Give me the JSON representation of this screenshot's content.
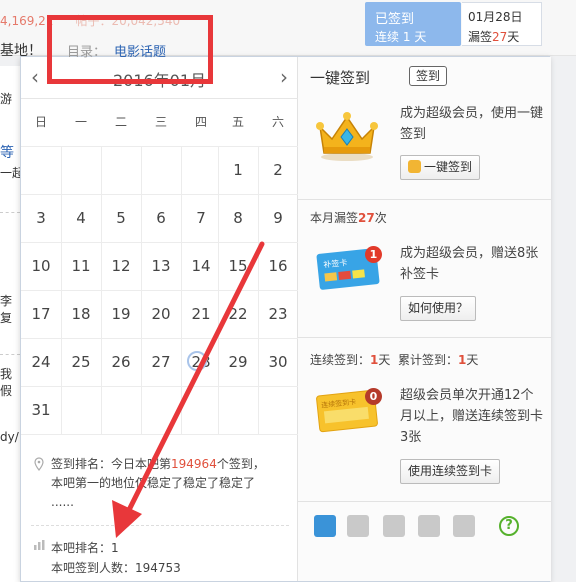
{
  "background": {
    "stat_text": "4,169,21",
    "stat_text_blurred": "帖子：20,042,540",
    "forum_title": "基地！",
    "left_items": [
      "游",
      "等",
      "一起",
      "李",
      "复",
      "我",
      "假",
      "dy/"
    ]
  },
  "sign_widget": {
    "status": "已签到",
    "streak_prefix": "连续",
    "streak_days": "1",
    "streak_suffix": "天",
    "date": "01月28日",
    "missed_prefix": "漏签",
    "missed_count": "27",
    "missed_suffix": "天"
  },
  "catalog": {
    "label": "目录：",
    "link": "电影话题"
  },
  "calendar": {
    "title": "2016年01月",
    "prev": "‹",
    "next": "›",
    "weekdays": [
      "日",
      "一",
      "二",
      "三",
      "四",
      "五",
      "六"
    ],
    "today": "28",
    "rows": [
      [
        "",
        "",
        "",
        "",
        "",
        "1",
        "2"
      ],
      [
        "3",
        "4",
        "5",
        "6",
        "7",
        "8",
        "9"
      ],
      [
        "10",
        "11",
        "12",
        "13",
        "14",
        "15",
        "16"
      ],
      [
        "17",
        "18",
        "19",
        "20",
        "21",
        "22",
        "23"
      ],
      [
        "24",
        "25",
        "26",
        "27",
        "28",
        "29",
        "30"
      ],
      [
        "31",
        "",
        "",
        "",
        "",
        "",
        ""
      ]
    ]
  },
  "ranking": {
    "sign_rank_prefix": "签到排名：今日本吧第",
    "sign_rank_num": "194964",
    "sign_rank_suffix": "个签到，",
    "sign_rank_line2": "本吧第一的地位仅稳定了稳定了稳定了",
    "sign_rank_line3": "......",
    "bar_rank": "本吧排名：1",
    "bar_signers": "本吧签到人数：194753"
  },
  "right_panel": {
    "title": "一键签到",
    "tag": "签到",
    "vip_text": "成为超级会员，使用一键签到",
    "onekey_btn": "一键签到",
    "missed_label": "本月漏签",
    "missed_count": "27",
    "missed_suffix": "次",
    "card_badge": "1",
    "card_text": "成为超级会员，赠送8张补签卡",
    "card_label": "补签卡",
    "howto_btn": "如何使用？",
    "streak_label": "连续签到：",
    "streak_num": "1",
    "streak_unit": "天",
    "total_label": "累计签到：",
    "total_num": "1",
    "total_unit": "天",
    "streak_card_badge": "0",
    "streak_card_text": "超级会员单次开通12个月以上，赠送连续签到卡3张",
    "streak_card_label": "连续签到卡",
    "use_card_btn": "使用连续签到卡"
  },
  "colors": {
    "accent_red": "#e0503c",
    "sign_blue": "#8db8ec",
    "annotation_red": "#e8373a",
    "link_blue": "#2d64b3"
  }
}
